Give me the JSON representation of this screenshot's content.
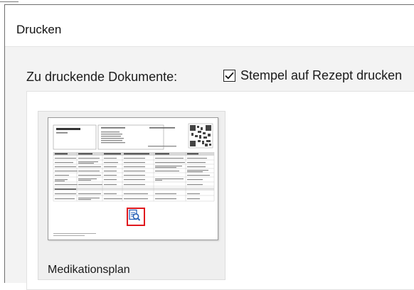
{
  "dialog": {
    "title": "Drucken",
    "documents_label": "Zu druckende Dokumente:",
    "stamp_option": {
      "label": "Stempel auf Rezept drucken",
      "checked": true
    }
  },
  "documents": [
    {
      "name": "Medikationsplan",
      "preview_icon": "zoom-preview-icon"
    }
  ],
  "colors": {
    "highlight": "#e0191e",
    "icon_blue": "#2a63b8"
  }
}
